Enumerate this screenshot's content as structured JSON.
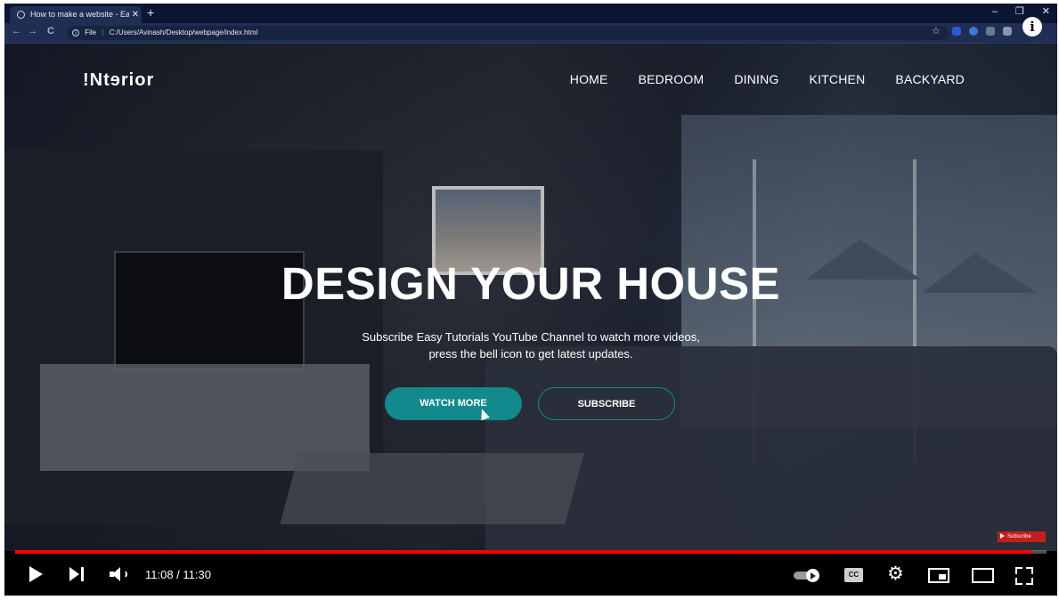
{
  "browser": {
    "tab_title": "How to make a website - Easy Tu",
    "tab_close": "✕",
    "new_tab": "+",
    "window_controls": [
      "–",
      "❐",
      "✕"
    ],
    "nav_back": "←",
    "nav_forward": "→",
    "nav_reload": "C",
    "address_scheme_label": "File",
    "address_url": "C:/Users/Avinash/Desktop/webpage/index.html",
    "bookmark_star": "☆",
    "extension_colors": [
      "#2a5bd7",
      "#3a7bd5",
      "#6b7a95",
      "#8a96ad",
      "#8a96ad"
    ]
  },
  "site": {
    "logo": "!Ntɘrior",
    "nav": [
      "HOME",
      "BEDROOM",
      "DINING",
      "KITCHEN",
      "BACKYARD"
    ],
    "hero_title": "DESIGN YOUR HOUSE",
    "hero_sub_line1": "Subscribe Easy Tutorials YouTube Channel to watch more videos,",
    "hero_sub_line2": "press the bell icon to get latest updates.",
    "btn_watch": "WATCH MORE",
    "btn_subscribe": "SUBSCRIBE",
    "accent_color": "#12898d"
  },
  "player": {
    "subscribe_badge": "Subscribe",
    "time": "11:08 / 11:30",
    "progress_fraction": 0.9855,
    "cc_label": "CC",
    "settings_glyph": "⚙",
    "info_glyph": "i",
    "progress_color": "#ff0000"
  }
}
